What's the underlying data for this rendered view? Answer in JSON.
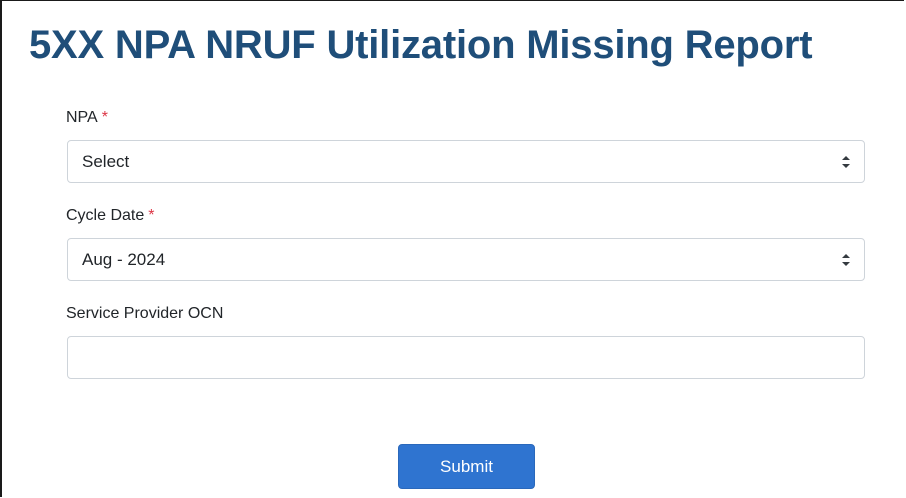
{
  "page": {
    "title": "5XX NPA NRUF Utilization Missing Report"
  },
  "form": {
    "npa": {
      "label": "NPA",
      "required_marker": "*",
      "selected_value": "Select",
      "icon": "sort-arrows-icon"
    },
    "cycle_date": {
      "label": "Cycle Date",
      "required_marker": "*",
      "selected_value": "Aug - 2024",
      "icon": "sort-arrows-icon"
    },
    "service_provider_ocn": {
      "label": "Service Provider OCN",
      "value": "",
      "placeholder": ""
    },
    "submit_label": "Submit"
  },
  "colors": {
    "title": "#1f4e79",
    "required": "#dc3545",
    "submit_bg": "#2f74d0",
    "border": "#ced4da"
  }
}
